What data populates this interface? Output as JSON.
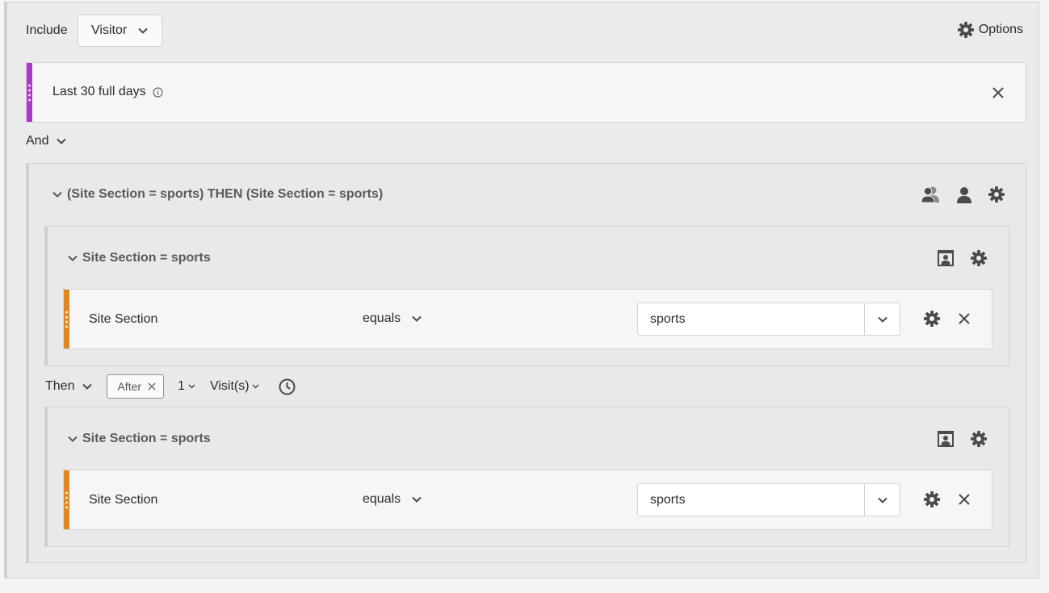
{
  "header": {
    "include_label": "Include",
    "scope_value": "Visitor",
    "options_label": "Options"
  },
  "date_range": {
    "label": "Last 30 full days"
  },
  "logic": {
    "operator": "And"
  },
  "sequence": {
    "title": "(Site Section = sports) THEN (Site Section = sports)",
    "checkpoints": [
      {
        "title": "Site Section = sports",
        "condition": {
          "dimension": "Site Section",
          "operator": "equals",
          "value": "sports"
        }
      },
      {
        "title": "Site Section = sports",
        "condition": {
          "dimension": "Site Section",
          "operator": "equals",
          "value": "sports"
        }
      }
    ],
    "then": {
      "label": "Then",
      "restriction": "After",
      "count": "1",
      "unit": "Visit(s)"
    }
  },
  "colors": {
    "date_accent": "#a83ac4",
    "condition_accent": "#e68619"
  }
}
